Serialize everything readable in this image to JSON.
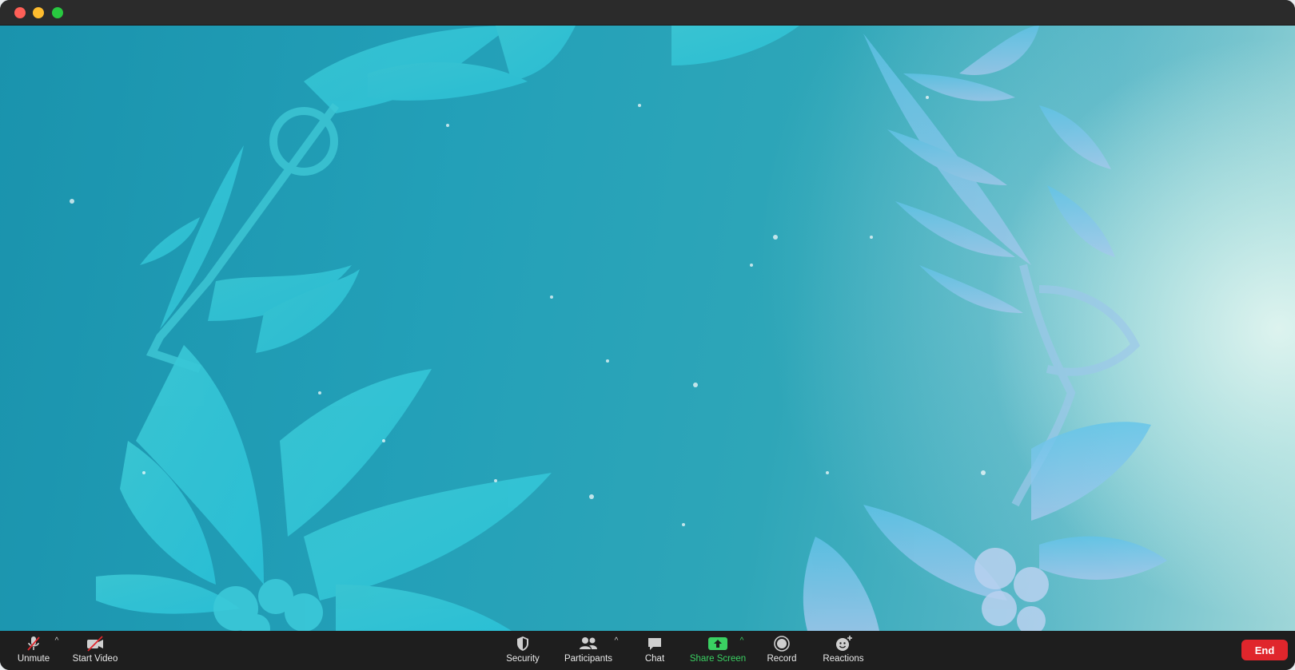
{
  "window": {
    "title": ""
  },
  "toolbar": {
    "unmute_label": "Unmute",
    "start_video_label": "Start Video",
    "security_label": "Security",
    "participants_label": "Participants",
    "chat_label": "Chat",
    "share_screen_label": "Share Screen",
    "record_label": "Record",
    "reactions_label": "Reactions",
    "end_label": "End"
  },
  "colors": {
    "close": "#ff5f57",
    "minimize": "#febc2e",
    "maximize": "#28c840",
    "share_green": "#3ad062",
    "end_red": "#e0262c"
  },
  "icons": {
    "unmute": "muted-microphone-icon",
    "start_video": "video-off-icon",
    "security": "shield-icon",
    "participants": "people-icon",
    "chat": "chat-bubble-icon",
    "share_screen": "share-arrow-icon",
    "record": "record-icon",
    "reactions": "smiley-plus-icon"
  }
}
